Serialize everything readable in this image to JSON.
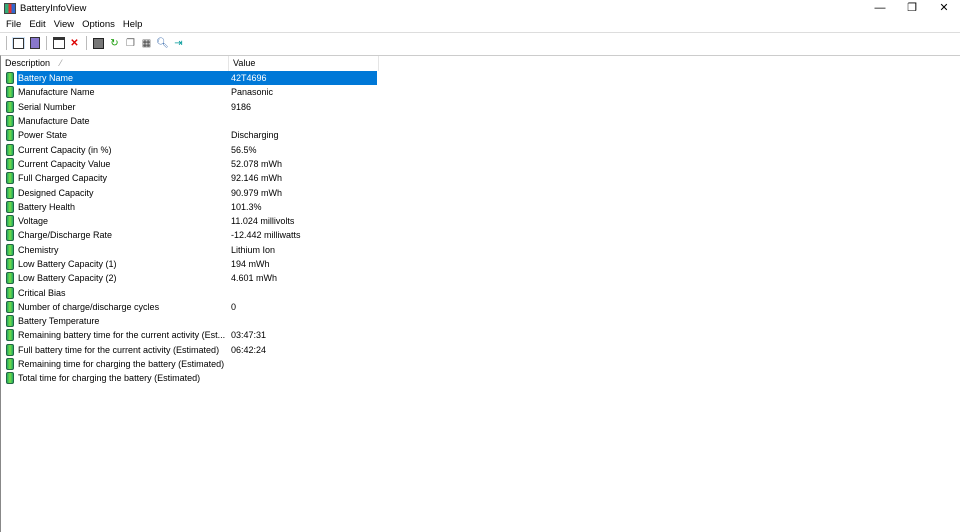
{
  "window": {
    "title": "BatteryInfoView",
    "minimize": "—",
    "restore": "❐",
    "close": "✕"
  },
  "menu": [
    "File",
    "Edit",
    "View",
    "Options",
    "Help"
  ],
  "toolbar": [
    "view-icon",
    "html-icon",
    "properties-icon",
    "delete-icon",
    "save-icon",
    "refresh-icon",
    "copy-icon",
    "options-icon",
    "find-icon",
    "exit-icon"
  ],
  "columns": {
    "description": "Description",
    "value": "Value",
    "sort_indicator": "⁄"
  },
  "rows": [
    {
      "d": "Battery Name",
      "v": "42T4696"
    },
    {
      "d": "Manufacture Name",
      "v": "Panasonic"
    },
    {
      "d": "Serial Number",
      "v": " 9186"
    },
    {
      "d": "Manufacture Date",
      "v": ""
    },
    {
      "d": "Power State",
      "v": "Discharging"
    },
    {
      "d": "Current Capacity (in %)",
      "v": "56.5%"
    },
    {
      "d": "Current Capacity Value",
      "v": "52.078 mWh"
    },
    {
      "d": "Full Charged Capacity",
      "v": "92.146 mWh"
    },
    {
      "d": "Designed Capacity",
      "v": "90.979 mWh"
    },
    {
      "d": "Battery Health",
      "v": "101.3%"
    },
    {
      "d": "Voltage",
      "v": "11.024 millivolts"
    },
    {
      "d": "Charge/Discharge Rate",
      "v": "-12.442 milliwatts"
    },
    {
      "d": "Chemistry",
      "v": "Lithium Ion"
    },
    {
      "d": "Low Battery Capacity (1)",
      "v": "194 mWh"
    },
    {
      "d": "Low Battery Capacity (2)",
      "v": "4.601 mWh"
    },
    {
      "d": "Critical Bias",
      "v": ""
    },
    {
      "d": "Number of charge/discharge cycles",
      "v": "0"
    },
    {
      "d": "Battery Temperature",
      "v": ""
    },
    {
      "d": "Remaining battery time for the current activity (Est...",
      "v": "03:47:31"
    },
    {
      "d": "Full battery time for the current activity (Estimated)",
      "v": "06:42:24"
    },
    {
      "d": "Remaining time for charging the battery (Estimated)",
      "v": ""
    },
    {
      "d": "Total  time for charging the battery (Estimated)",
      "v": ""
    }
  ],
  "selected_index": 0,
  "colors": {
    "selection": "#0078d7"
  }
}
